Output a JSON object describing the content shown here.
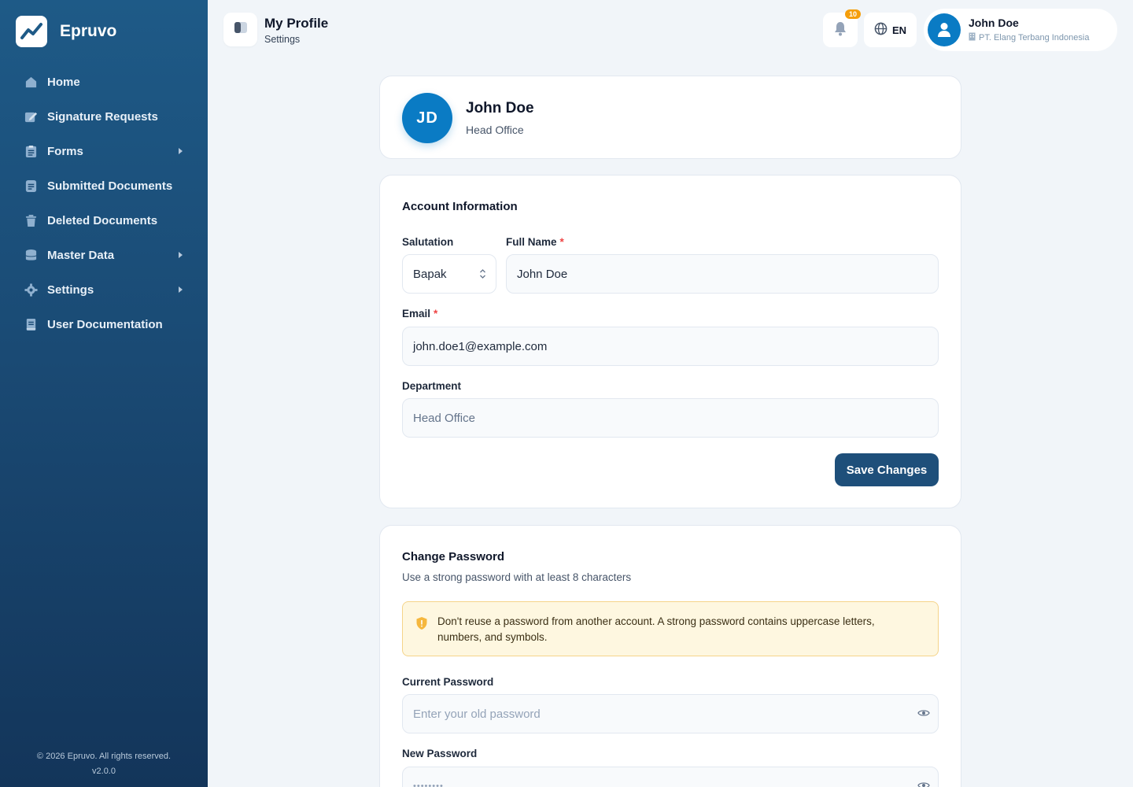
{
  "sidebar": {
    "brand": "Epruvo",
    "items": [
      {
        "label": "Home",
        "icon": "home-icon",
        "has_children": false
      },
      {
        "label": "Signature Requests",
        "icon": "signature-icon",
        "has_children": false
      },
      {
        "label": "Forms",
        "icon": "clipboard-icon",
        "has_children": true
      },
      {
        "label": "Submitted Documents",
        "icon": "document-icon",
        "has_children": false
      },
      {
        "label": "Deleted Documents",
        "icon": "trash-icon",
        "has_children": false
      },
      {
        "label": "Master Data",
        "icon": "database-icon",
        "has_children": true
      },
      {
        "label": "Settings",
        "icon": "gear-icon",
        "has_children": true
      },
      {
        "label": "User Documentation",
        "icon": "book-icon",
        "has_children": false
      }
    ],
    "footer_copyright": "© 2026 Epruvo. All rights reserved.",
    "footer_version": "v2.0.0"
  },
  "header": {
    "title": "My Profile",
    "subtitle": "Settings",
    "notification_count": "10",
    "language": "EN",
    "user_name": "John Doe",
    "user_company": "PT. Elang Terbang Indonesia"
  },
  "profile": {
    "initials": "JD",
    "name": "John Doe",
    "department": "Head Office"
  },
  "account": {
    "title": "Account Information",
    "salutation_label": "Salutation",
    "salutation_value": "Bapak",
    "fullname_label": "Full Name",
    "fullname_value": "John Doe",
    "email_label": "Email",
    "email_value": "john.doe1@example.com",
    "department_label": "Department",
    "department_value": "Head Office",
    "required_mark": "*",
    "save_label": "Save Changes"
  },
  "password": {
    "title": "Change Password",
    "subtitle": "Use a strong password with at least 8 characters",
    "warning": "Don't reuse a password from another account. A strong password contains uppercase letters, numbers, and symbols.",
    "current_label": "Current Password",
    "current_placeholder": "Enter your old password",
    "new_label": "New Password",
    "new_placeholder": "••••••••"
  },
  "colors": {
    "sidebar": "#1a4a74",
    "primary": "#1e4f7a",
    "avatar": "#0a7bc4",
    "badge": "#f59e0b",
    "required": "#ef4444",
    "warning_bg": "#fef7e0"
  }
}
